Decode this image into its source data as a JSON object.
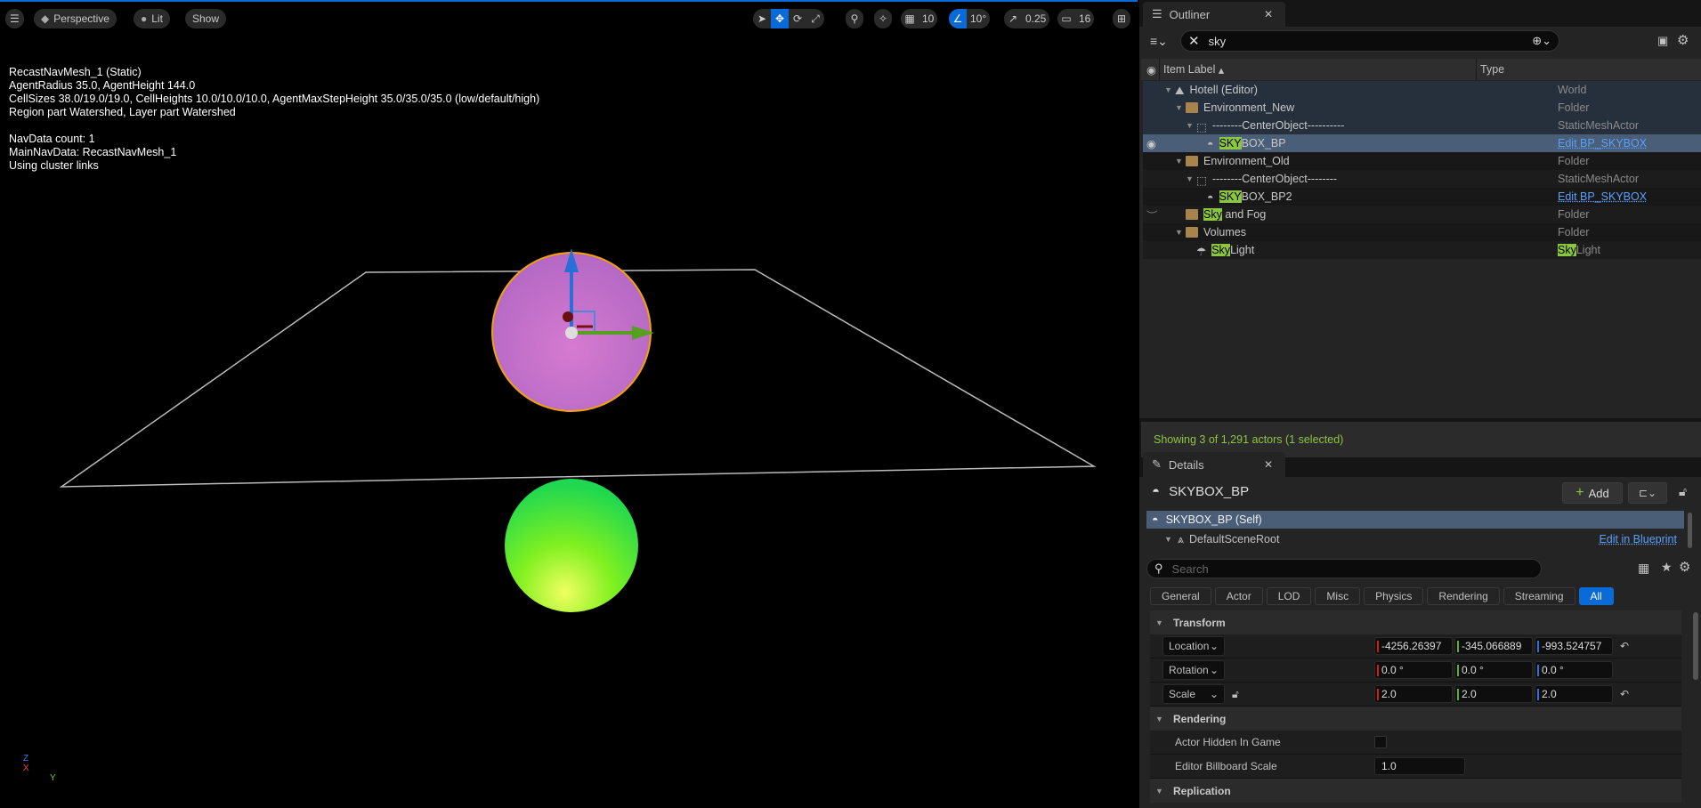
{
  "viewport": {
    "menu_icon": "hamburger-icon",
    "perspective_label": "Perspective",
    "lit_label": "Lit",
    "show_label": "Show",
    "grid_snap": "10",
    "rotation_snap": "10°",
    "scale_snap": "0.25",
    "camera_speed": "16",
    "nav_info": [
      "RecastNavMesh_1 (Static)",
      "AgentRadius 35.0, AgentHeight 144.0",
      "CellSizes 38.0/19.0/19.0, CellHeights 10.0/10.0/10.0, AgentMaxStepHeight 35.0/35.0/35.0 (low/default/high)",
      "Region part Watershed, Layer part Watershed",
      "",
      "NavData count: 1",
      "MainNavData: RecastNavMesh_1",
      "Using cluster links"
    ],
    "axis_z": "Z",
    "axis_x": "X",
    "axis_y": "Y",
    "accent": "#0a6ad8"
  },
  "outliner": {
    "tab_label": "Outliner",
    "search_value": "sky",
    "col_label": "Item Label",
    "col_type": "Type",
    "rows": [
      {
        "pre": "",
        "hl": "",
        "post": "Hotell (Editor)",
        "type": "World",
        "indent": 1,
        "icon": "world-icon"
      },
      {
        "pre": "",
        "hl": "",
        "post": "Environment_New",
        "type": "Folder",
        "indent": 2,
        "icon": "folder-open-icon"
      },
      {
        "pre": "",
        "hl": "",
        "post": "--------CenterObject----------",
        "type": "StaticMeshActor",
        "indent": 3,
        "icon": "static-mesh-icon"
      },
      {
        "pre": "",
        "hl": "SKY",
        "post": "BOX_BP",
        "type": "Edit BP_SKYBOX",
        "indent": 4,
        "icon": "blueprint-actor-icon",
        "selected": true
      },
      {
        "pre": "",
        "hl": "",
        "post": "Environment_Old",
        "type": "Folder",
        "indent": 2,
        "icon": "folder-open-icon"
      },
      {
        "pre": "",
        "hl": "",
        "post": "--------CenterObject--------",
        "type": "StaticMeshActor",
        "indent": 3,
        "icon": "static-mesh-icon"
      },
      {
        "pre": "",
        "hl": "SKY",
        "post": "BOX_BP2",
        "type": "Edit BP_SKYBOX",
        "indent": 4,
        "icon": "blueprint-actor-icon"
      },
      {
        "pre": "",
        "hl": "Sky",
        "post": " and Fog",
        "type": "Folder",
        "indent": 2,
        "icon": "folder-icon"
      },
      {
        "pre": "",
        "hl": "",
        "post": "Volumes",
        "type": "Folder",
        "indent": 2,
        "icon": "folder-open-icon"
      },
      {
        "pre": "",
        "hl": "Sky",
        "post": "Light",
        "type_hl": "Sky",
        "type": "Light",
        "indent": 3,
        "icon": "skylight-icon"
      }
    ],
    "status": "Showing 3 of 1,291 actors (1 selected)"
  },
  "details": {
    "tab_label": "Details",
    "actor_name": "SKYBOX_BP",
    "add_label": "Add",
    "self_label": "SKYBOX_BP (Self)",
    "root_label": "DefaultSceneRoot",
    "edit_bp_label": "Edit in Blueprint",
    "search_placeholder": "Search",
    "filters": [
      "General",
      "Actor",
      "LOD",
      "Misc",
      "Physics",
      "Rendering",
      "Streaming",
      "All"
    ],
    "transform_label": "Transform",
    "location_label": "Location",
    "location": [
      "-4256.26397",
      "-345.066889",
      "-993.524757"
    ],
    "rotation_label": "Rotation",
    "rotation": [
      "0.0 °",
      "0.0 °",
      "0.0 °"
    ],
    "scale_label": "Scale",
    "scale": [
      "2.0",
      "2.0",
      "2.0"
    ],
    "rendering_label": "Rendering",
    "hidden_label": "Actor Hidden In Game",
    "hidden_value": false,
    "billboard_label": "Editor Billboard Scale",
    "billboard_value": "1.0",
    "replication_label": "Replication"
  }
}
